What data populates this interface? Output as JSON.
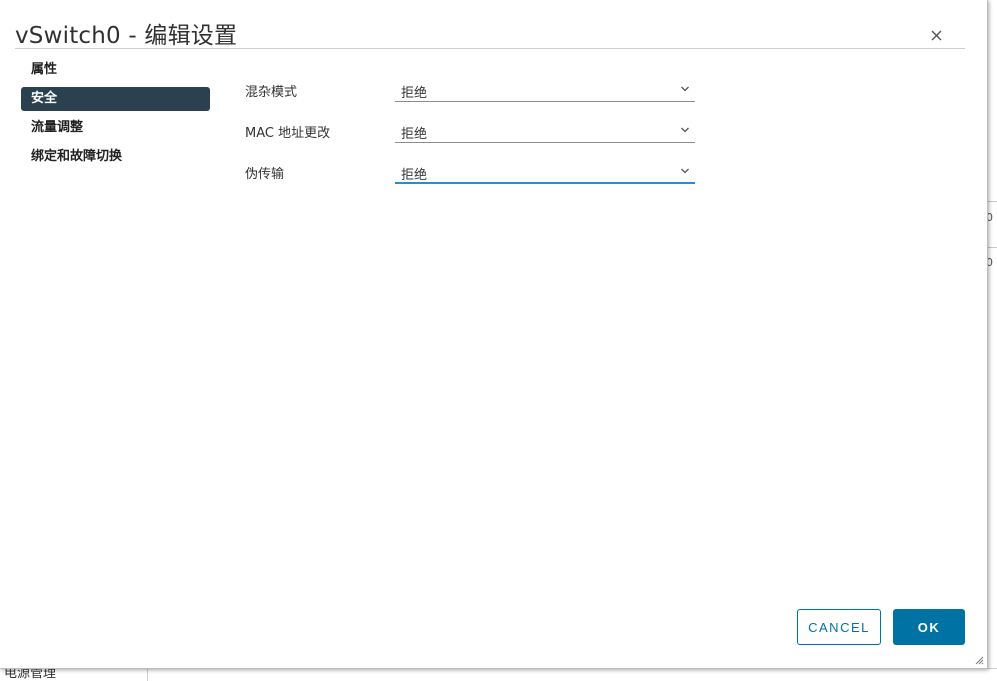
{
  "background": {
    "bottom_text": "电源管理",
    "right_glyphs": [
      "0",
      "0"
    ]
  },
  "dialog": {
    "title": "vSwitch0 - 编辑设置",
    "close_icon": "close-icon"
  },
  "nav": {
    "items": [
      {
        "label": "属性",
        "active": false
      },
      {
        "label": "安全",
        "active": true
      },
      {
        "label": "流量调整",
        "active": false
      },
      {
        "label": "绑定和故障切换",
        "active": false
      }
    ]
  },
  "form": {
    "rows": [
      {
        "label": "混杂模式",
        "value": "拒绝"
      },
      {
        "label": "MAC 地址更改",
        "value": "拒绝"
      },
      {
        "label": "伪传输",
        "value": "拒绝"
      }
    ]
  },
  "buttons": {
    "cancel": "CANCEL",
    "ok": "OK"
  },
  "colors": {
    "active_nav": "#2b4150",
    "primary": "#0072a3",
    "focus": "#2c8bc9"
  }
}
